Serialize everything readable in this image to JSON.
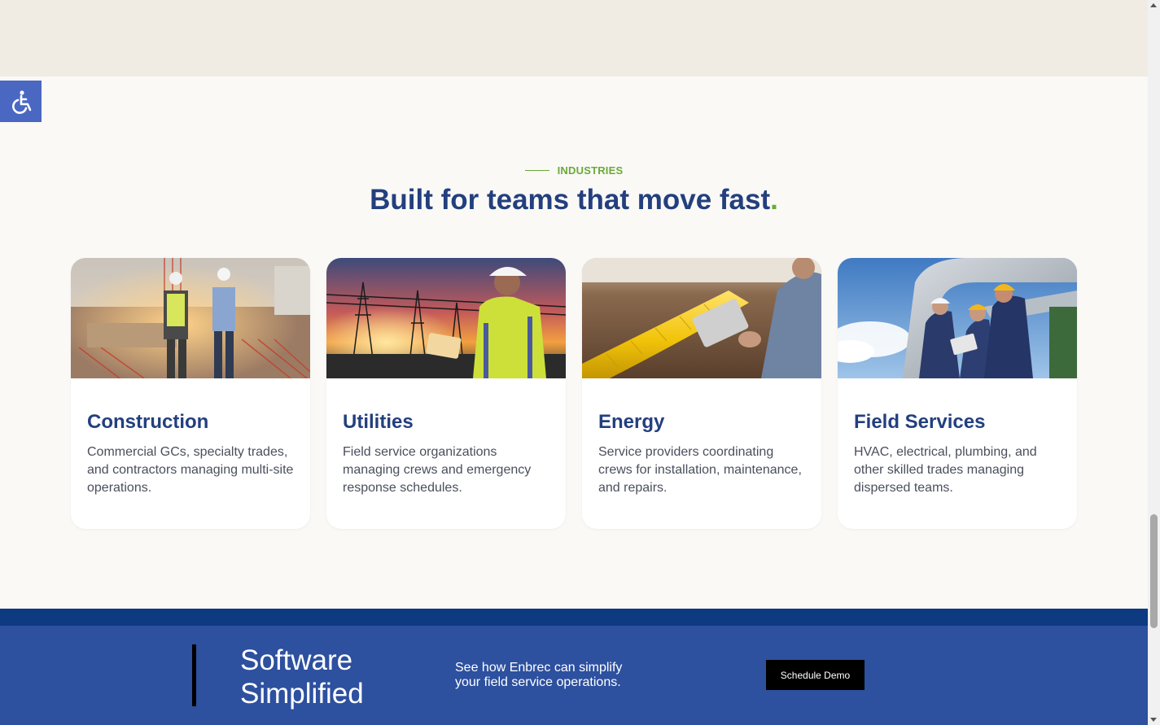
{
  "accessibility": {
    "icon": "wheelchair-icon",
    "color": "#4a67c2"
  },
  "industries": {
    "eyebrow": "INDUSTRIES",
    "headline": "Built for teams that move fast",
    "headline_dot": ".",
    "accent_color": "#6aaa3a",
    "heading_color": "#233f7e",
    "cards": [
      {
        "title": "Construction",
        "description": "Commercial GCs, specialty trades, and contractors managing multi-site operations.",
        "image": "construction-site-photo"
      },
      {
        "title": "Utilities",
        "description": "Field service organizations managing crews and emergency response schedules.",
        "image": "utility-worker-sunset-photo"
      },
      {
        "title": "Energy",
        "description": "Service providers coordinating crews for installation, maintenance, and repairs.",
        "image": "gas-pipeline-tablet-photo"
      },
      {
        "title": "Field Services",
        "description": "HVAC, electrical, plumbing, and other skilled trades managing dispersed teams.",
        "image": "technicians-pipes-photo"
      }
    ]
  },
  "cta": {
    "brand": "Software Simplified",
    "copy": "See how Enbrec can simplify your field service operations.",
    "button_label": "Schedule Demo",
    "background_color": "#2d509f"
  }
}
